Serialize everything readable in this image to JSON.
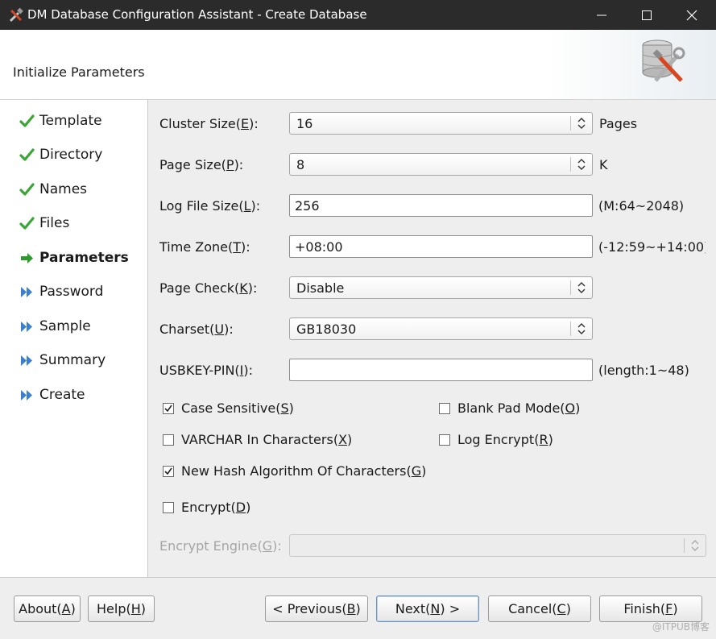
{
  "window": {
    "title": "DM Database Configuration Assistant - Create Database"
  },
  "header": {
    "heading": "Initialize Parameters"
  },
  "sidebar": {
    "steps": [
      {
        "label": "Template",
        "status": "done"
      },
      {
        "label": "Directory",
        "status": "done"
      },
      {
        "label": "Names",
        "status": "done"
      },
      {
        "label": "Files",
        "status": "done"
      },
      {
        "label": "Parameters",
        "status": "current"
      },
      {
        "label": "Password",
        "status": "pending"
      },
      {
        "label": "Sample",
        "status": "pending"
      },
      {
        "label": "Summary",
        "status": "pending"
      },
      {
        "label": "Create",
        "status": "pending"
      }
    ]
  },
  "form": {
    "cluster_size": {
      "label_pre": "Cluster Size(",
      "mnemonic": "E",
      "label_post": "):",
      "value": "16",
      "suffix": "Pages"
    },
    "page_size": {
      "label_pre": "Page Size(",
      "mnemonic": "P",
      "label_post": "):",
      "value": "8",
      "suffix": "K"
    },
    "log_file_size": {
      "label_pre": "Log File Size(",
      "mnemonic": "L",
      "label_post": "):",
      "value": "256",
      "suffix": "(M:64~2048)"
    },
    "time_zone": {
      "label_pre": "Time Zone(",
      "mnemonic": "T",
      "label_post": "):",
      "value": "+08:00",
      "suffix": "(-12:59~+14:00)"
    },
    "page_check": {
      "label_pre": "Page Check(",
      "mnemonic": "K",
      "label_post": "):",
      "value": "Disable"
    },
    "charset": {
      "label_pre": "Charset(",
      "mnemonic": "U",
      "label_post": "):",
      "value": "GB18030"
    },
    "usbkey_pin": {
      "label_pre": "USBKEY-PIN(",
      "mnemonic": "I",
      "label_post": "):",
      "value": "",
      "suffix": "(length:1~48)"
    },
    "encrypt_engine": {
      "label_pre": "Encrypt Engine(",
      "mnemonic": "G",
      "label_post": "):",
      "value": ""
    }
  },
  "checks": {
    "case_sensitive": {
      "label_pre": "Case Sensitive(",
      "mnemonic": "S",
      "label_post": ")",
      "checked": true
    },
    "blank_pad_mode": {
      "label_pre": "Blank Pad Mode(",
      "mnemonic": "O",
      "label_post": ")",
      "checked": false
    },
    "varchar_in_chars": {
      "label_pre": "VARCHAR In Characters(",
      "mnemonic": "X",
      "label_post": ")",
      "checked": false
    },
    "log_encrypt": {
      "label_pre": "Log Encrypt(",
      "mnemonic": "R",
      "label_post": ")",
      "checked": false
    },
    "new_hash": {
      "label_pre": "New Hash Algorithm Of Characters(",
      "mnemonic": "G",
      "label_post": ")",
      "checked": true
    },
    "encrypt": {
      "label_pre": "Encrypt(",
      "mnemonic": "D",
      "label_post": ")",
      "checked": false
    }
  },
  "buttons": {
    "about": {
      "pre": "About(",
      "mn": "A",
      "post": ")"
    },
    "help": {
      "pre": "Help(",
      "mn": "H",
      "post": ")"
    },
    "previous": {
      "pre": "< Previous(",
      "mn": "B",
      "post": ")"
    },
    "next": {
      "pre": "Next(",
      "mn": "N",
      "post": ") >"
    },
    "cancel": {
      "pre": "Cancel(",
      "mn": "C",
      "post": ")"
    },
    "finish": {
      "pre": "Finish(",
      "mn": "F",
      "post": ")"
    }
  },
  "watermark": "@ITPUB博客",
  "colors": {
    "titlebar": "#2b2b2b",
    "done_check": "#3aa635",
    "current_arrow": "#2e9a2e",
    "pending_arrow": "#3b7fd1"
  }
}
